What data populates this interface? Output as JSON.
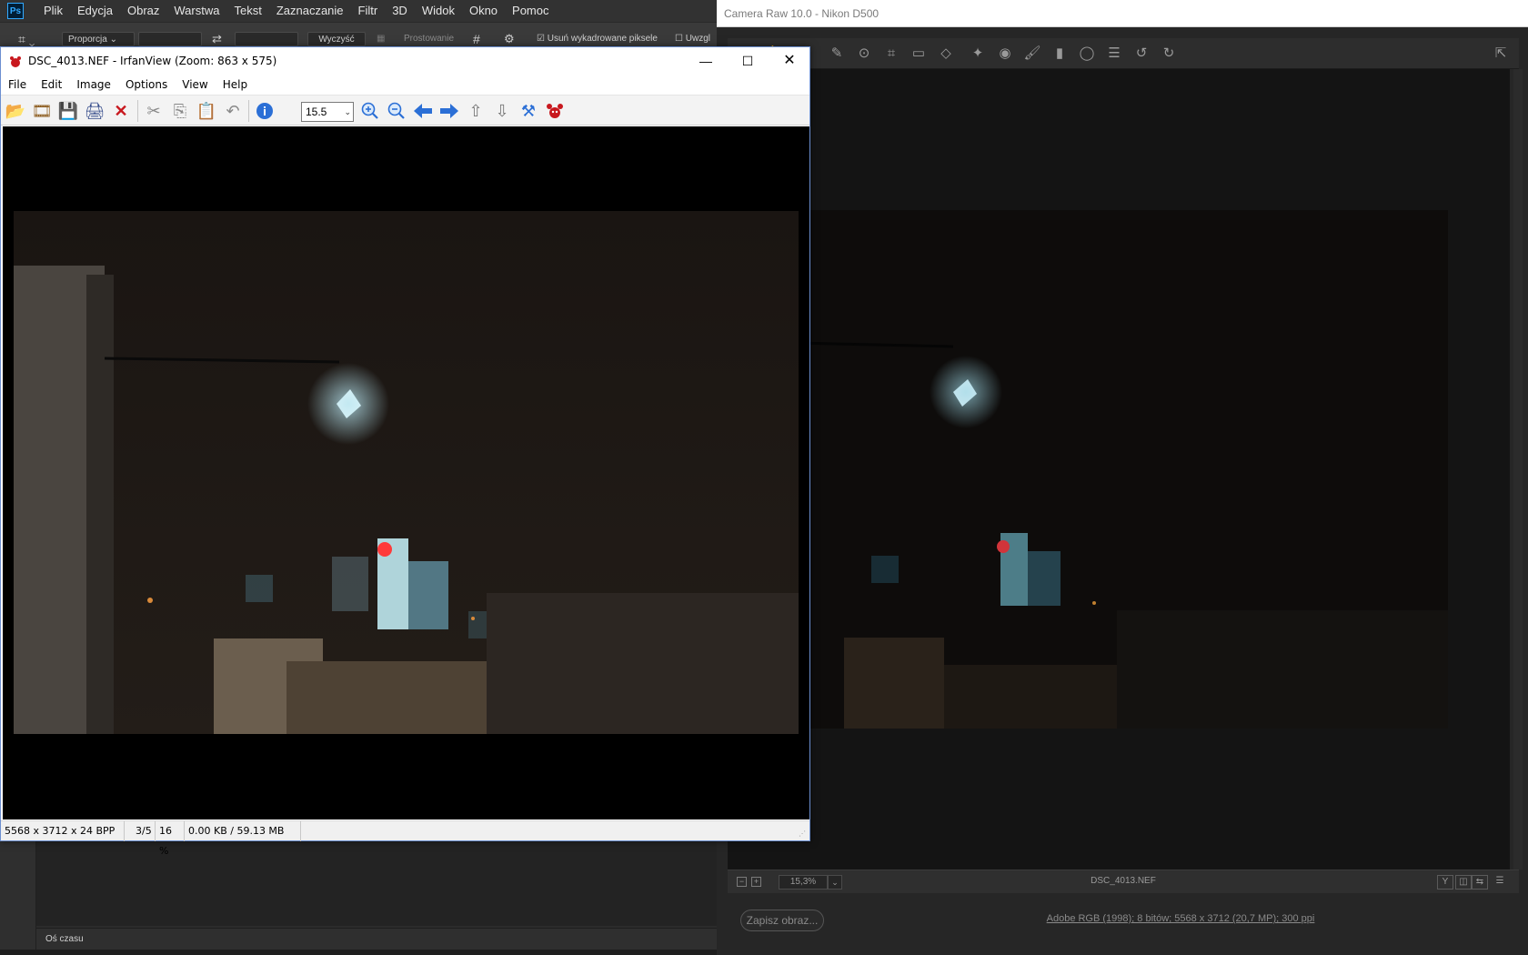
{
  "photoshop": {
    "logo": "Ps",
    "menu": [
      "Plik",
      "Edycja",
      "Obraz",
      "Warstwa",
      "Tekst",
      "Zaznaczanie",
      "Filtr",
      "3D",
      "Widok",
      "Okno",
      "Pomoc"
    ],
    "options": {
      "ratio_label": "Proporcja",
      "clear_label": "Wyczyść",
      "straighten_label": "Prostowanie",
      "delete_cropped_label": "Usuń wykadrowane piksele",
      "content_aware_label": "Uwzgl"
    },
    "timeline_label": "Oś czasu"
  },
  "camera_raw": {
    "title": "Camera Raw 10.0  -  Nikon D500",
    "zoom_value": "15,3%",
    "filename": "DSC_4013.NEF",
    "save_button": "Zapisz obraz...",
    "workflow_info": "Adobe RGB (1998); 8 bitów; 5568 x 3712 (20,7 MP); 300 ppi"
  },
  "irfanview": {
    "title": "DSC_4013.NEF - IrfanView (Zoom: 863 x 575)",
    "menu": [
      "File",
      "Edit",
      "Image",
      "Options",
      "View",
      "Help"
    ],
    "zoom_value": "15.5",
    "status": {
      "dimensions": "5568 x 3712 x 24 BPP",
      "index": "3/5",
      "zoom_percent": "16 %",
      "size": "0.00 KB / 59.13 MB"
    }
  },
  "colors": {
    "ps_bg": "#232323",
    "cr_bg": "#141414",
    "accent_blue": "#2b6fd6",
    "irfan_red": "#c8181e"
  }
}
